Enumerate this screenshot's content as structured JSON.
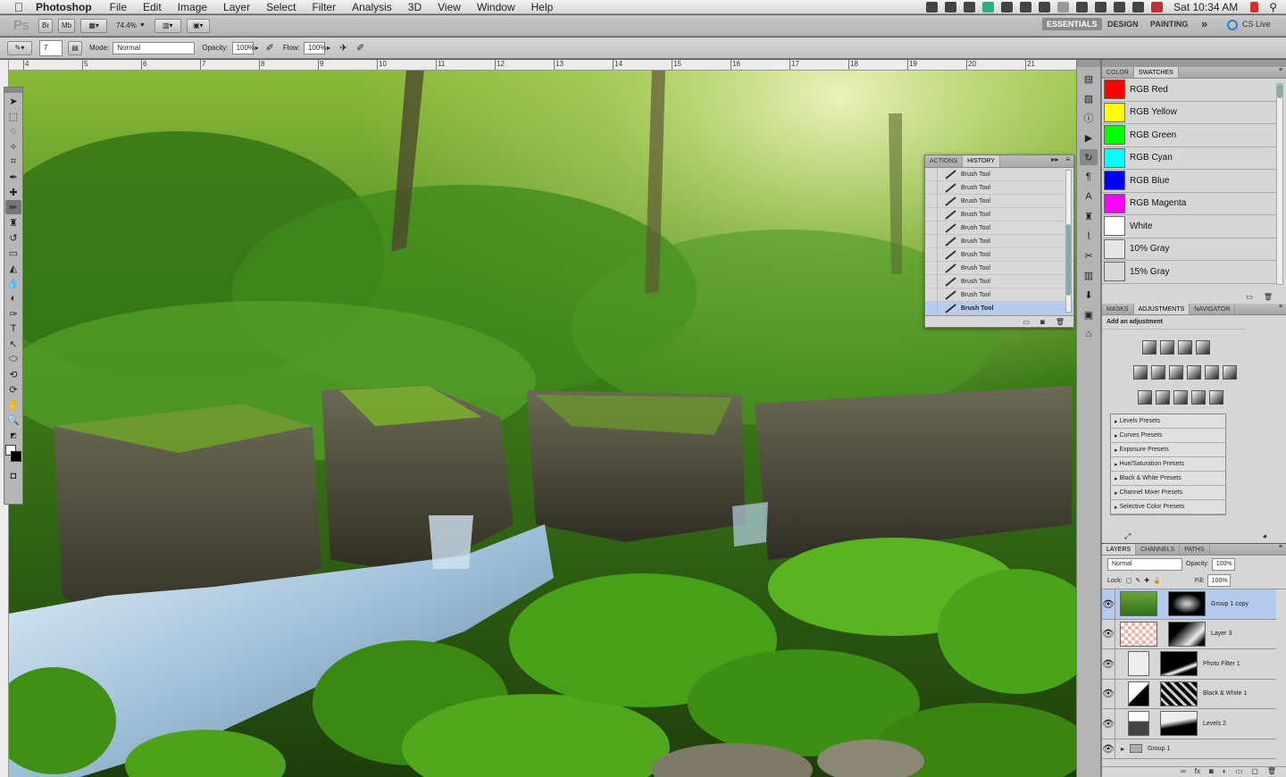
{
  "menubar": {
    "app_name": "Photoshop",
    "items": [
      "File",
      "Edit",
      "Image",
      "Layer",
      "Select",
      "Filter",
      "Analysis",
      "3D",
      "View",
      "Window",
      "Help"
    ],
    "clock": "Sat 10:34 AM"
  },
  "appbar": {
    "ps_logo": "Ps",
    "br_label": "Br",
    "mb_label": "Mb",
    "zoom": "74.4%",
    "workspaces": [
      "ESSENTIALS",
      "DESIGN",
      "PAINTING"
    ],
    "more": "»",
    "cs_live": "CS Live"
  },
  "options": {
    "brush_size": "7",
    "mode_label": "Mode:",
    "mode_value": "Normal",
    "opacity_label": "Opacity:",
    "opacity_value": "100%",
    "flow_label": "Flow:",
    "flow_value": "100%"
  },
  "ruler": {
    "h_numbers": [
      "4",
      "5",
      "6",
      "7",
      "8",
      "9",
      "10",
      "11",
      "12",
      "13",
      "14",
      "15",
      "16",
      "17",
      "18",
      "19",
      "20",
      "21"
    ]
  },
  "history_panel": {
    "tabs": [
      "ACTIONS",
      "HISTORY"
    ],
    "active_tab": "HISTORY",
    "items": [
      "Brush Tool",
      "Brush Tool",
      "Brush Tool",
      "Brush Tool",
      "Brush Tool",
      "Brush Tool",
      "Brush Tool",
      "Brush Tool",
      "Brush Tool",
      "Brush Tool",
      "Brush Tool"
    ],
    "selected_index": 10
  },
  "swatches_panel": {
    "tabs": [
      "COLOR",
      "SWATCHES"
    ],
    "active_tab": "SWATCHES",
    "swatches": [
      {
        "name": "RGB Red",
        "color": "#ff0000"
      },
      {
        "name": "RGB Yellow",
        "color": "#ffff00"
      },
      {
        "name": "RGB Green",
        "color": "#00ff00"
      },
      {
        "name": "RGB Cyan",
        "color": "#00ffff"
      },
      {
        "name": "RGB Blue",
        "color": "#0000ff"
      },
      {
        "name": "RGB Magenta",
        "color": "#ff00ff"
      },
      {
        "name": "White",
        "color": "#ffffff"
      },
      {
        "name": "10% Gray",
        "color": "#e6e6e6"
      },
      {
        "name": "15% Gray",
        "color": "#d9d9d9"
      }
    ]
  },
  "adjustments_panel": {
    "tabs": [
      "MASKS",
      "ADJUSTMENTS",
      "NAVIGATOR"
    ],
    "active_tab": "ADJUSTMENTS",
    "heading": "Add an adjustment",
    "presets": [
      "Levels Presets",
      "Curves Presets",
      "Exposure Presets",
      "Hue/Saturation Presets",
      "Black & White Presets",
      "Channel Mixer Presets",
      "Selective Color Presets"
    ]
  },
  "layers_panel": {
    "tabs": [
      "LAYERS",
      "CHANNELS",
      "PATHS"
    ],
    "active_tab": "LAYERS",
    "blend_mode": "Normal",
    "opacity_label": "Opacity:",
    "opacity_value": "100%",
    "lock_label": "Lock:",
    "fill_label": "Fill:",
    "fill_value": "100%",
    "layers": [
      {
        "name": "Group 1 copy",
        "selected": true
      },
      {
        "name": "Layer 3",
        "selected": false
      },
      {
        "name": "Photo Filter 1",
        "selected": false
      },
      {
        "name": "Black & White 1",
        "selected": false
      },
      {
        "name": "Levels 2",
        "selected": false
      },
      {
        "name": "Group 1",
        "selected": false
      }
    ]
  },
  "colors": {
    "selection_blue": "#b3c9ee",
    "panel_gray": "#d6d6d6"
  }
}
